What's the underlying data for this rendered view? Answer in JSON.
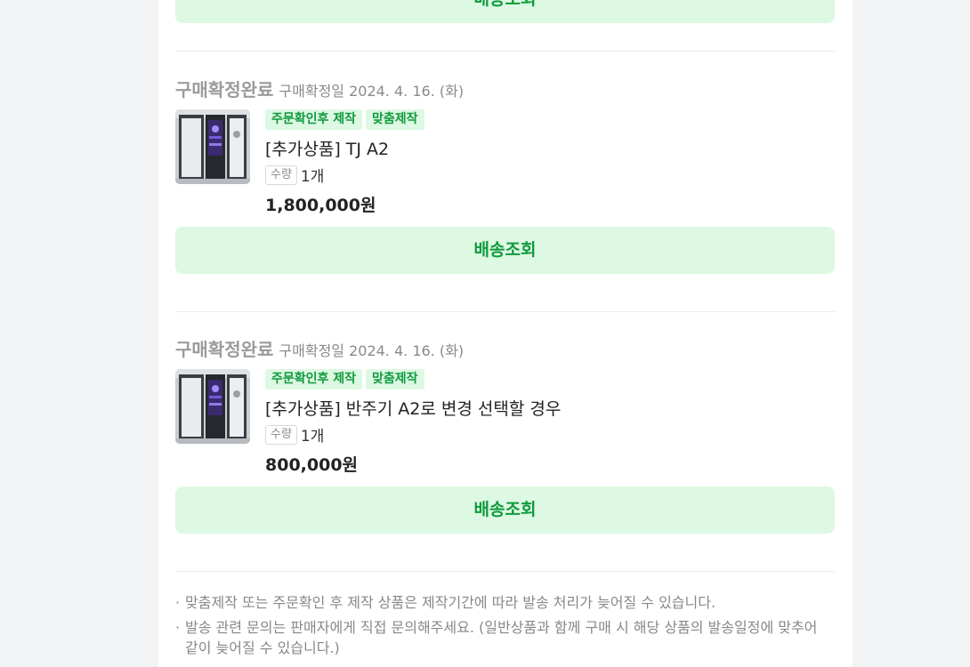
{
  "top_button": {
    "label": "배송조회"
  },
  "orders": [
    {
      "status": "구매확정완료",
      "confirm_label": "구매확정일 2024. 4. 16. (화)",
      "thumbnail_icon": "product-cabinet-image",
      "tags": [
        "주문확인후 제작",
        "맞춤제작"
      ],
      "product_name": "[추가상품] TJ A2",
      "qty_label": "수량",
      "qty_value": "1개",
      "price": "1,800,000원",
      "button_label": "배송조회"
    },
    {
      "status": "구매확정완료",
      "confirm_label": "구매확정일 2024. 4. 16. (화)",
      "thumbnail_icon": "product-cabinet-image",
      "tags": [
        "주문확인후 제작",
        "맞춤제작"
      ],
      "product_name": "[추가상품] 반주기 A2로 변경 선택할 경우",
      "qty_label": "수량",
      "qty_value": "1개",
      "price": "800,000원",
      "button_label": "배송조회"
    }
  ],
  "notices": [
    "맞춤제작 또는 주문확인 후 제작 상품은 제작기간에 따라 발송 처리가 늦어질 수 있습니다.",
    "발송 관련 문의는 판매자에게 직접 문의해주세요. (일반상품과 함께 구매 시 해당 상품의 발송일정에 맞추어 같이 늦어질 수 있습니다.)"
  ],
  "colors": {
    "accent_green": "#0f9a3c",
    "button_bg": "#ddf8e3",
    "status_gray": "#9b9b9b"
  }
}
